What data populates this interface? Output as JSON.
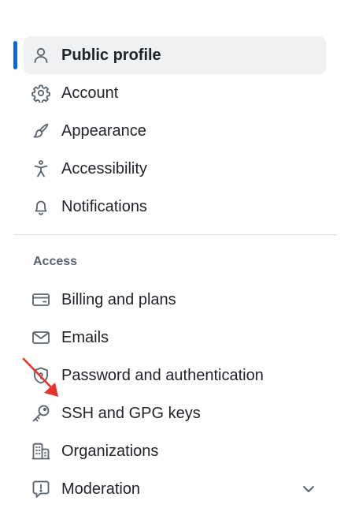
{
  "nav": {
    "items": [
      {
        "label": "Public profile",
        "icon": "person-icon",
        "active": true
      },
      {
        "label": "Account",
        "icon": "gear-icon"
      },
      {
        "label": "Appearance",
        "icon": "paintbrush-icon"
      },
      {
        "label": "Accessibility",
        "icon": "accessibility-icon"
      },
      {
        "label": "Notifications",
        "icon": "bell-icon"
      }
    ],
    "access_heading": "Access",
    "access_items": [
      {
        "label": "Billing and plans",
        "icon": "credit-card-icon"
      },
      {
        "label": "Emails",
        "icon": "mail-icon"
      },
      {
        "label": "Password and authentication",
        "icon": "shield-lock-icon"
      },
      {
        "label": "SSH and GPG keys",
        "icon": "key-icon"
      },
      {
        "label": "Organizations",
        "icon": "organization-icon"
      },
      {
        "label": "Moderation",
        "icon": "report-icon",
        "expandable": true
      }
    ]
  },
  "colors": {
    "active_bar": "#0969da",
    "active_bg": "#f0f1f3",
    "annotation_arrow": "#e8322c"
  }
}
